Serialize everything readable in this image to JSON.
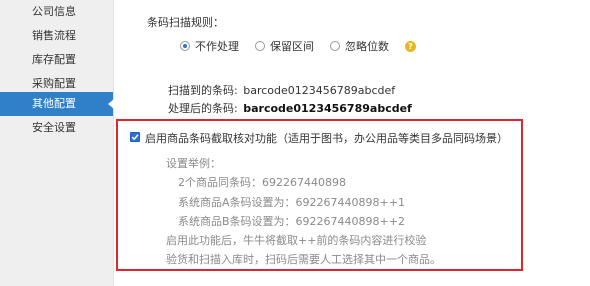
{
  "sidebar": {
    "items": [
      {
        "label": "公司信息"
      },
      {
        "label": "销售流程"
      },
      {
        "label": "库存配置"
      },
      {
        "label": "采购配置"
      },
      {
        "label": "其他配置",
        "active": true
      },
      {
        "label": "安全设置"
      }
    ]
  },
  "barcode_rule": {
    "label": "条码扫描规则：",
    "options": [
      "不作处理",
      "保留区间",
      "忽略位数"
    ],
    "selected": "不作处理",
    "help_glyph": "?"
  },
  "scanned": {
    "label": "扫描到的条码:",
    "value": "barcode0123456789abcdef"
  },
  "processed": {
    "label": "处理后的条码:",
    "value": "barcode0123456789abcdef"
  },
  "intercept": {
    "checked": true,
    "label": "启用商品条码截取核对功能（适用于图书，办公用品等类目多品同码场景）",
    "example_title": "设置举例：",
    "lines": [
      "2个商品同条码：692267440898",
      "系统商品A条码设置为：692267440898++1",
      "系统商品B条码设置为：692267440898++2"
    ],
    "note1": "启用此功能后，牛牛将截取++前的条码内容进行校验",
    "note2": "验货和扫描入库时，扫码后需要人工选择其中一个商品。"
  },
  "colors": {
    "active_nav": "#2f80c8",
    "highlight_border": "#e0262b",
    "radio_selected": "#2e6fd1"
  }
}
